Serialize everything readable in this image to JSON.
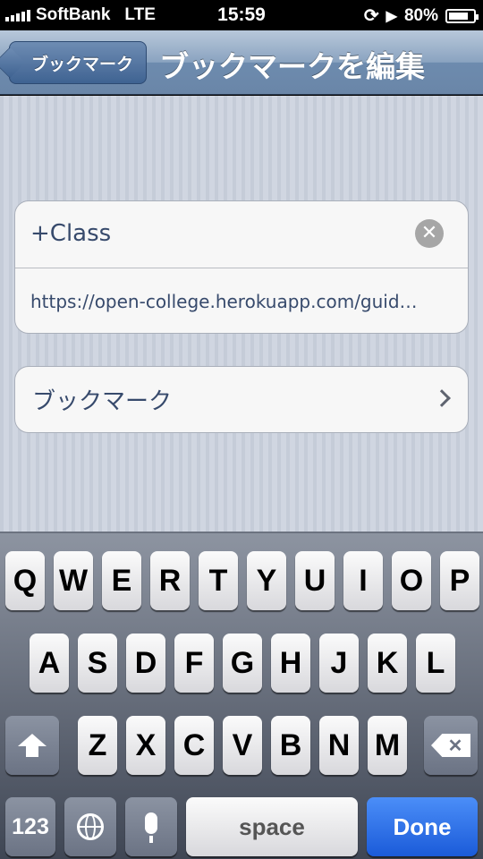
{
  "status_bar": {
    "carrier": "SoftBank",
    "network": "LTE",
    "time": "15:59",
    "battery": "80%",
    "battery_level": 0.8,
    "icons": [
      "signal-icon",
      "rotation-lock-icon",
      "location-icon",
      "battery-icon"
    ]
  },
  "nav": {
    "back_label": "ブックマーク",
    "title": "ブックマークを編集"
  },
  "form": {
    "title_value": "+Class",
    "url_value": "https://open-college.herokuapp.com/guid…",
    "folder_label": "ブックマーク"
  },
  "keyboard": {
    "row1": [
      "Q",
      "W",
      "E",
      "R",
      "T",
      "Y",
      "U",
      "I",
      "O",
      "P"
    ],
    "row2": [
      "A",
      "S",
      "D",
      "F",
      "G",
      "H",
      "J",
      "K",
      "L"
    ],
    "row3": [
      "Z",
      "X",
      "C",
      "V",
      "B",
      "N",
      "M"
    ],
    "numbers_label": "123",
    "space_label": "space",
    "done_label": "Done"
  },
  "colors": {
    "done_blue": "#1b5bd9",
    "nav_blue": "#6d8bae",
    "text_blue": "#374a6c"
  }
}
